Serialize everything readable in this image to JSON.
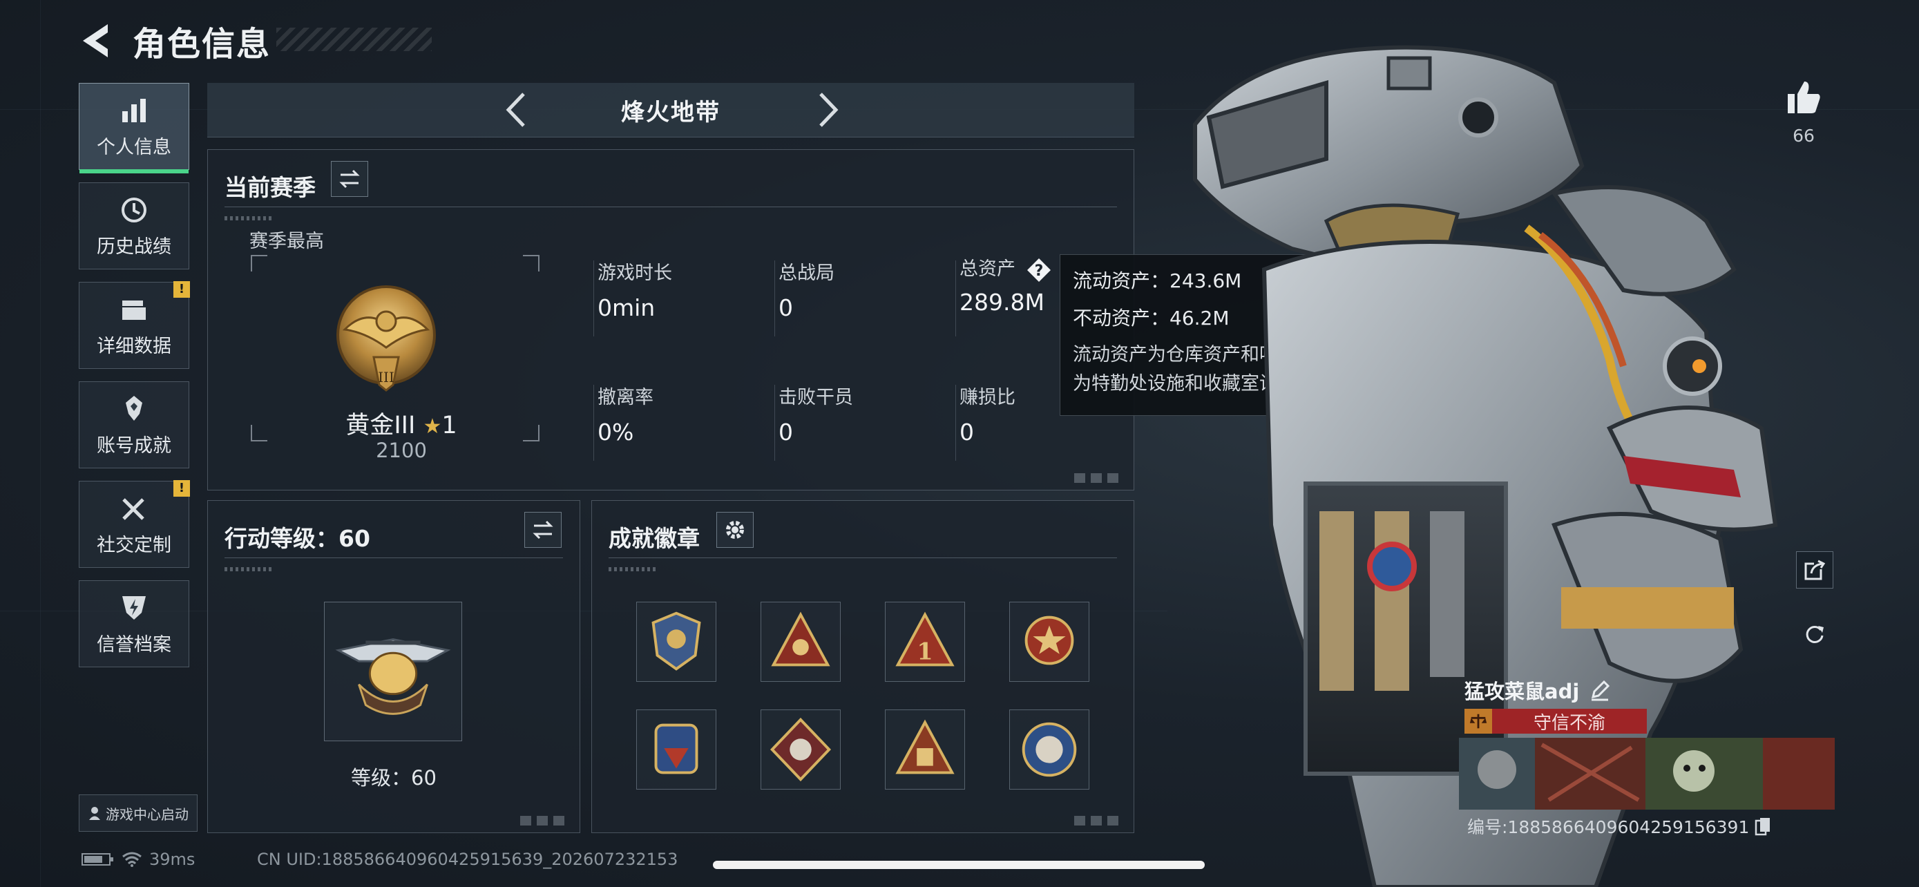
{
  "header": {
    "title": "角色信息"
  },
  "nav": {
    "items": [
      {
        "label": "个人信息",
        "icon": "bar-chart-icon",
        "active": true,
        "badge": ""
      },
      {
        "label": "历史战绩",
        "icon": "history-icon",
        "active": false,
        "badge": ""
      },
      {
        "label": "详细数据",
        "icon": "folder-icon",
        "active": false,
        "badge": "!"
      },
      {
        "label": "账号成就",
        "icon": "medal-icon",
        "active": false,
        "badge": ""
      },
      {
        "label": "社交定制",
        "icon": "tools-icon",
        "active": false,
        "badge": "!"
      },
      {
        "label": "信誉档案",
        "icon": "shield-bolt-icon",
        "active": false,
        "badge": ""
      }
    ],
    "game_center": "游戏中心启动"
  },
  "mode_bar": {
    "title": "烽火地带"
  },
  "season": {
    "title": "当前赛季",
    "best_label": "赛季最高",
    "rank_name": "黄金III",
    "rank_star": "★",
    "rank_star_count": "1",
    "rank_score": "2100",
    "stats": [
      {
        "label": "游戏时长",
        "value": "0min"
      },
      {
        "label": "总战局",
        "value": "0"
      },
      {
        "label": "总资产",
        "value": "289.8M"
      },
      {
        "label": "撤离率",
        "value": "0%"
      },
      {
        "label": "击败干员",
        "value": "0"
      },
      {
        "label": "赚损比",
        "value": "0"
      }
    ]
  },
  "tooltip": {
    "liquid": "流动资产：243.6M",
    "fixed": "不动资产：46.2M",
    "desc1": "流动资产为仓库资产和哈夫币，不动资产",
    "desc2": "为特勤处设施和收藏室设施"
  },
  "level": {
    "title": "行动等级：60",
    "caption": "等级：60"
  },
  "achievements": {
    "title": "成就徽章"
  },
  "profile": {
    "likes": "66",
    "player_name": "猛攻菜鼠adj",
    "credit": "守信不渝",
    "uid_line": "编号:1885866409604259156391"
  },
  "status": {
    "ping": "39ms",
    "cn_uid": "CN UID:1885866409604259156​39_202607232153"
  },
  "colors": {
    "active_green": "#4ad48a",
    "badge_yellow": "#e5b53a",
    "credit_red": "#9e2426"
  }
}
